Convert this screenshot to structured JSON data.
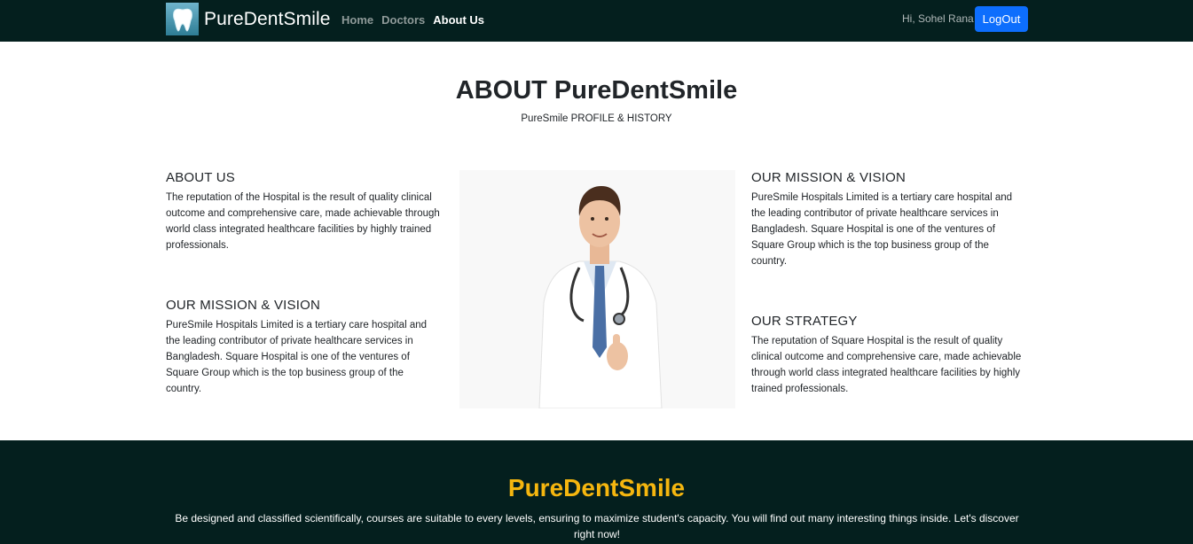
{
  "navbar": {
    "brand": "PureDentSmile",
    "links": [
      {
        "label": "Home",
        "active": false
      },
      {
        "label": "Doctors",
        "active": false
      },
      {
        "label": "About Us",
        "active": true
      }
    ],
    "greeting": "Hi, Sohel Rana",
    "logout_label": "LogOut"
  },
  "header": {
    "title": "ABOUT PureDentSmile",
    "subtitle": "PureSmile PROFILE & HISTORY"
  },
  "left": {
    "about": {
      "heading": "ABOUT US",
      "text": "The reputation of the Hospital is the result of quality clinical outcome and comprehensive care, made achievable through world class integrated healthcare facilities by highly trained professionals."
    },
    "mission": {
      "heading": "OUR MISSION & VISION",
      "text": "PureSmile Hospitals Limited is a tertiary care hospital and the leading contributor of private healthcare services in Bangladesh. Square Hospital is one of the ventures of Square Group which is the top business group of the country."
    }
  },
  "right": {
    "mission": {
      "heading": "OUR MISSION & VISION",
      "text": "PureSmile Hospitals Limited is a tertiary care hospital and the leading contributor of private healthcare services in Bangladesh. Square Hospital is one of the ventures of Square Group which is the top business group of the country."
    },
    "strategy": {
      "heading": "OUR STRATEGY",
      "text": "The reputation of Square Hospital is the result of quality clinical outcome and comprehensive care, made achievable through world class integrated healthcare facilities by highly trained professionals."
    }
  },
  "footer": {
    "title": "PureDentSmile",
    "text": "Be designed and classified scientifically, courses are suitable to every levels, ensuring to maximize student's capacity. You will find out many interesting things inside. Let's discover right now!"
  },
  "colors": {
    "navbar_bg": "#041f1e",
    "logout_button": "#0d6efd",
    "footer_title": "#f5b60f"
  },
  "icons": {
    "brand_logo": "tooth-logo-icon",
    "doctor_image": "doctor-photo"
  }
}
